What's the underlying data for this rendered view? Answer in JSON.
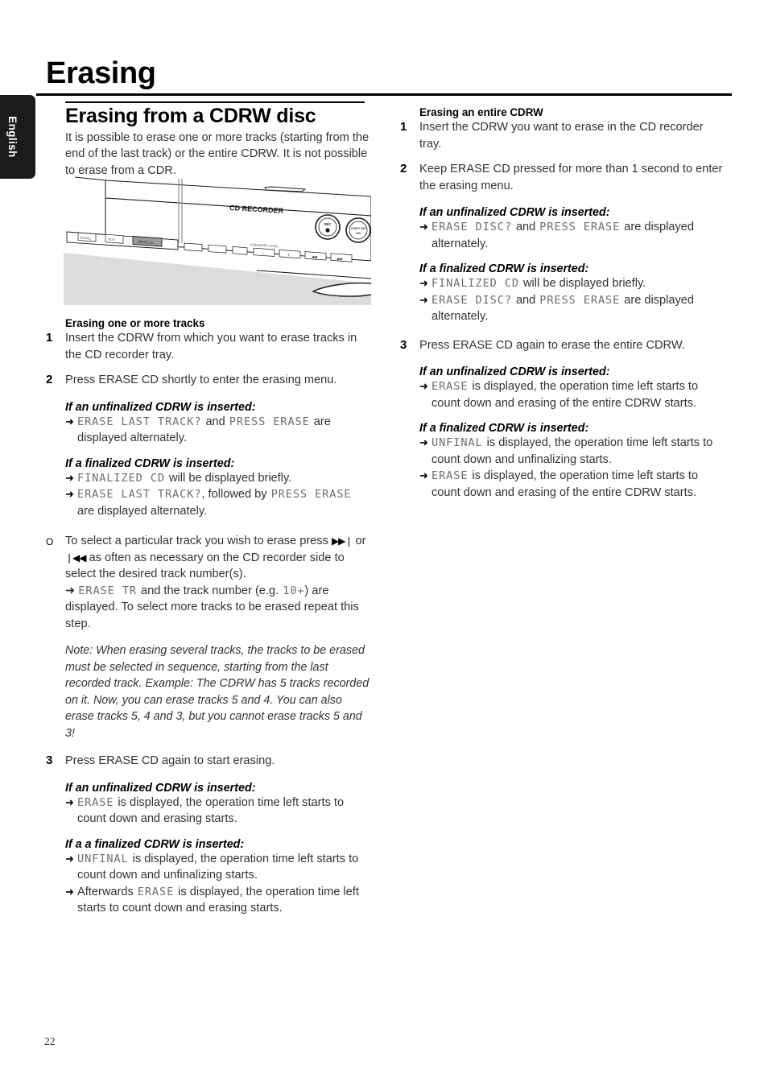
{
  "side_tab": {
    "label": "English"
  },
  "page_title": "Erasing",
  "page_number": "22",
  "left_column": {
    "section_title": "Erasing from a CDRW disc",
    "intro": "It is possible to erase one or more tracks (starting from the end of the last track) or the entire CDRW. It is not possible to erase from a CDR.",
    "illustration": {
      "brand_label": "CD RECORDER",
      "knob_rec": "REC",
      "knob_copy": "COPY CD",
      "level_label": "ALBUM/REC LEVEL",
      "button_erase": "ERASE CD",
      "button_scroll": "SCROLL",
      "button_text": "TEXT",
      "minus": "–",
      "plus": "+"
    },
    "sub_head": "Erasing one or more tracks",
    "step1_num": "1",
    "step1_text": "Insert the CDRW from which you want to erase tracks in the CD recorder tray.",
    "step2_num": "2",
    "step2_text": "Press ERASE CD shortly to enter the erasing menu.",
    "cond_unfinalized_1": "If an unfinalized CDRW is inserted:",
    "res_a_lcd1": "ERASE LAST TRACK?",
    "res_a_mid": "and",
    "res_a_lcd2": "PRESS ERASE",
    "res_a_tail": "are displayed alternately.",
    "cond_finalized_1": "If a finalized CDRW is inserted:",
    "res_b_lcd1": "FINALIZED CD",
    "res_b_tail": "will be displayed briefly.",
    "res_c_lcd1": "ERASE LAST TRACK?",
    "res_c_mid": ", followed by",
    "res_c_lcd2": "PRESS ERASE",
    "res_c_tail": "are displayed alternately.",
    "bullet_mark": "O",
    "bullet_text_1": "To select a particular track you wish to erase press",
    "bullet_icon_next": "▶▶❘",
    "bullet_text_2": "or",
    "bullet_icon_prev": "❘◀◀",
    "bullet_text_3": "as often as necessary on the CD recorder side to select the desired track number(s).",
    "bullet_res_lcd1": "ERASE TR",
    "bullet_res_mid": "and the track number (e.g.",
    "bullet_res_lcd2": "10+",
    "bullet_res_tail": ") are displayed.",
    "bullet_text_4": "To select more tracks to be erased repeat this step.",
    "note": "Note: When erasing several tracks, the tracks to be erased must be selected in sequence, starting from the last recorded track. Example: The CDRW has 5 tracks recorded on it. Now, you can erase tracks 5 and 4. You can also erase tracks 5, 4 and 3, but you cannot erase tracks 5 and 3!",
    "step3_num": "3",
    "step3_text": "Press ERASE CD again to start erasing.",
    "cond_unfinalized_2": "If an unfinalized CDRW is inserted:",
    "res_d_lcd1": "ERASE",
    "res_d_tail": "is displayed, the operation time left starts to count down and erasing starts.",
    "cond_finalized_2": "If a a finalized CDRW is inserted:",
    "res_e_lcd1": "UNFINAL",
    "res_e_tail": "is displayed, the operation time left starts to count down and unfinalizing starts.",
    "res_f_lead": "Afterwards",
    "res_f_lcd1": "ERASE",
    "res_f_tail": "is displayed, the operation time left starts to count down and erasing starts."
  },
  "right_column": {
    "sub_head": "Erasing an entire CDRW",
    "step1_num": "1",
    "step1_text": "Insert the CDRW you want to erase in the CD recorder tray.",
    "step2_num": "2",
    "step2_text": "Keep ERASE CD pressed for more than 1 second to enter the erasing menu.",
    "cond_unfinalized_1": "If an unfinalized CDRW is inserted:",
    "res_a_lcd1": "ERASE DISC?",
    "res_a_mid": "and",
    "res_a_lcd2": "PRESS ERASE",
    "res_a_tail": "are displayed alternately.",
    "cond_finalized_1": "If a finalized CDRW is inserted:",
    "res_b_lcd1": "FINALIZED CD",
    "res_b_tail": "will be displayed briefly.",
    "res_c_lcd1": "ERASE DISC?",
    "res_c_mid": "and",
    "res_c_lcd2": "PRESS ERASE",
    "res_c_tail": "are displayed alternately.",
    "step3_num": "3",
    "step3_text": "Press ERASE CD again to erase the entire CDRW.",
    "cond_unfinalized_2": "If an unfinalized CDRW is inserted:",
    "res_d_lcd1": "ERASE",
    "res_d_tail": "is displayed, the operation time left starts to count down and erasing of the entire CDRW starts.",
    "cond_finalized_2": "If a finalized CDRW is inserted:",
    "res_e_lcd1": "UNFINAL",
    "res_e_tail": "is displayed, the operation time left starts to count down and unfinalizing starts.",
    "res_f_lcd1": "ERASE",
    "res_f_tail": "is displayed, the operation time left starts to count down and erasing of the entire CDRW starts."
  },
  "colors": {
    "tab_bg": "#1b1b1b",
    "lcd_text": "#6e6e6e",
    "body_text": "#333333",
    "device_body": "#dcdcdc"
  }
}
